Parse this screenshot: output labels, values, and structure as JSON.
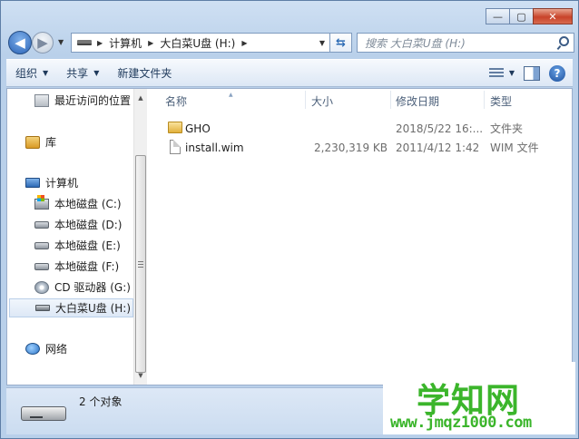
{
  "window": {
    "caption_buttons": {
      "minimize": "—",
      "maximize": "▢",
      "close": "✕"
    }
  },
  "address_bar": {
    "crumbs": [
      "计算机",
      "大白菜U盘 (H:)"
    ]
  },
  "search": {
    "placeholder": "搜索 大白菜U盘 (H:)"
  },
  "toolbar": {
    "organize": "组织",
    "share": "共享",
    "new_folder": "新建文件夹"
  },
  "nav_pane": {
    "items": [
      {
        "label": "最近访问的位置",
        "icon": "recent-places-icon"
      },
      {
        "label": "库",
        "icon": "library-icon"
      },
      {
        "label": "计算机",
        "icon": "computer-icon"
      },
      {
        "label": "本地磁盘 (C:)",
        "icon": "system-drive-icon"
      },
      {
        "label": "本地磁盘 (D:)",
        "icon": "drive-icon"
      },
      {
        "label": "本地磁盘 (E:)",
        "icon": "drive-icon"
      },
      {
        "label": "本地磁盘 (F:)",
        "icon": "drive-icon"
      },
      {
        "label": "CD 驱动器 (G:)",
        "icon": "cd-drive-icon"
      },
      {
        "label": "大白菜U盘 (H:)",
        "icon": "usb-drive-icon",
        "selected": true
      },
      {
        "label": "网络",
        "icon": "network-icon"
      }
    ]
  },
  "columns": {
    "name": "名称",
    "size": "大小",
    "modified": "修改日期",
    "type": "类型"
  },
  "files": [
    {
      "name": "GHO",
      "size": "",
      "modified": "2018/5/22 16:...",
      "type": "文件夹",
      "icon": "folder-icon"
    },
    {
      "name": "install.wim",
      "size": "2,230,319 KB",
      "modified": "2011/4/12 1:42",
      "type": "WIM 文件",
      "icon": "file-icon"
    }
  ],
  "status": {
    "count": "2 个对象"
  },
  "watermark": {
    "title": "学知网",
    "url": "www.jmqz1000.com"
  }
}
